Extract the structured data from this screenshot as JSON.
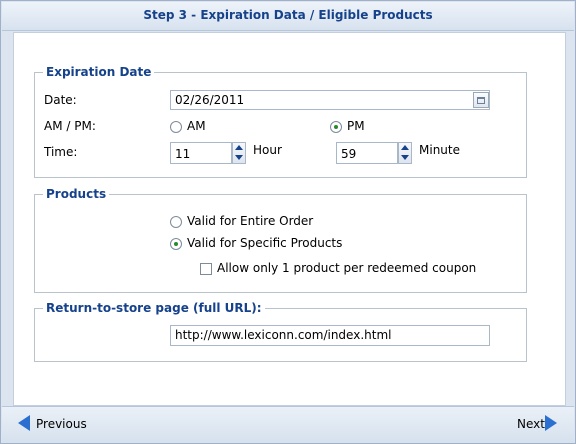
{
  "header": {
    "title": "Step 3 - Expiration Data / Eligible Products"
  },
  "expiration": {
    "legend": "Expiration Date",
    "date_label": "Date:",
    "date_value": "02/26/2011",
    "ampm_label": "AM / PM:",
    "am_label": "AM",
    "pm_label": "PM",
    "time_label": "Time:",
    "hour_value": "11",
    "hour_label": "Hour",
    "minute_value": "59",
    "minute_label": "Minute"
  },
  "products": {
    "legend": "Products",
    "option_entire": "Valid for Entire Order",
    "option_specific": "Valid for Specific Products",
    "allow_one": "Allow only 1 product per redeemed coupon"
  },
  "return_url": {
    "legend": "Return-to-store page (full URL):",
    "value": "http://www.lexiconn.com/index.html"
  },
  "footer": {
    "previous_label": "Previous",
    "next_label": "Next"
  }
}
